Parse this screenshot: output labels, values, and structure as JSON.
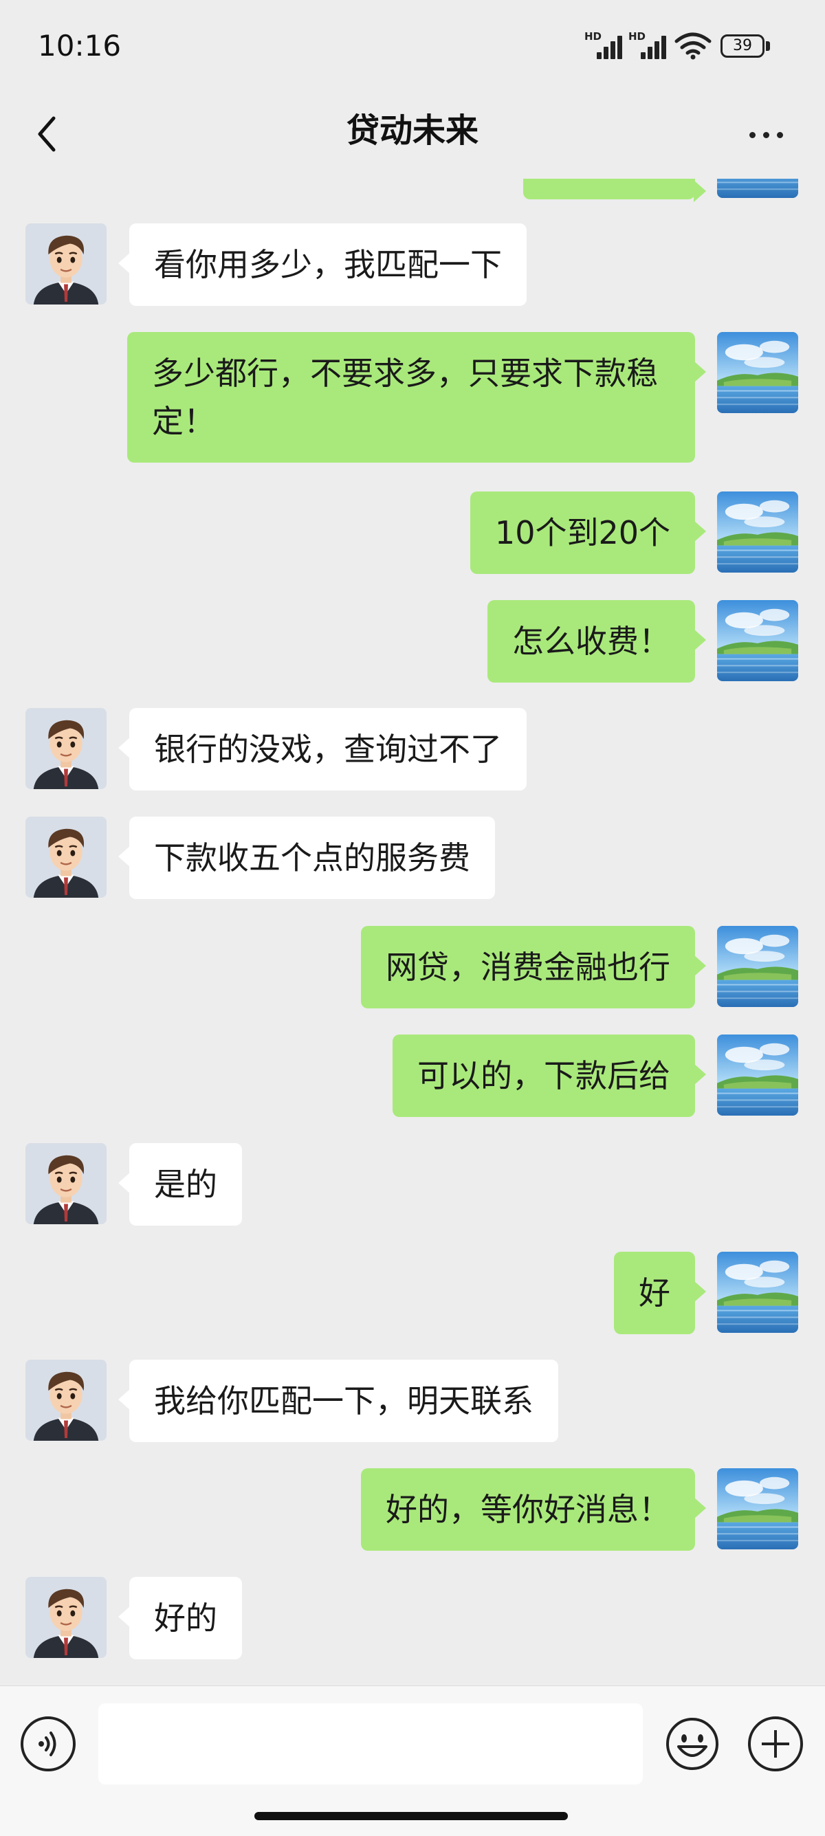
{
  "status_bar": {
    "time": "10:16",
    "signal1_label": "HD",
    "signal2_label": "HD",
    "battery": "39"
  },
  "header": {
    "title": "贷动未来"
  },
  "messages": [
    {
      "side": "in",
      "text": "看你用多少，我匹配一下"
    },
    {
      "side": "out",
      "text": "多少都行，不要求多，只要求下款稳定！"
    },
    {
      "side": "out",
      "text": "10个到20个"
    },
    {
      "side": "out",
      "text": "怎么收费！"
    },
    {
      "side": "in",
      "text": "银行的没戏，查询过不了"
    },
    {
      "side": "in",
      "text": "下款收五个点的服务费"
    },
    {
      "side": "out",
      "text": "网贷，消费金融也行"
    },
    {
      "side": "out",
      "text": "可以的，下款后给"
    },
    {
      "side": "in",
      "text": "是的"
    },
    {
      "side": "out",
      "text": "好"
    },
    {
      "side": "in",
      "text": "我给你匹配一下，明天联系"
    },
    {
      "side": "out",
      "text": "好的，等你好消息！"
    },
    {
      "side": "in",
      "text": "好的"
    }
  ],
  "input": {
    "value": ""
  },
  "colors": {
    "outgoing_bubble": "#a9e97b",
    "incoming_bubble": "#ffffff",
    "background": "#ededed"
  }
}
